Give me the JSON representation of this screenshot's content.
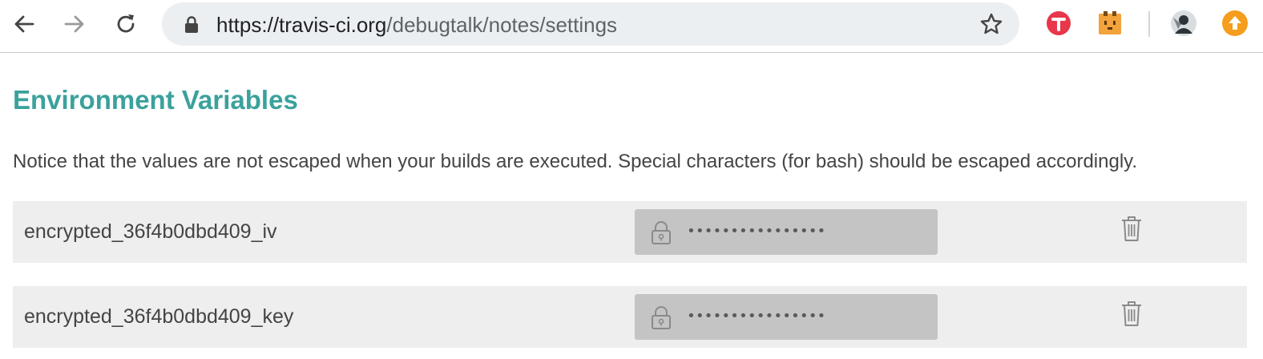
{
  "browser": {
    "url_host": "https://travis-ci.org",
    "url_path": "/debugtalk/notes/settings",
    "icons": [
      "back-arrow-icon",
      "forward-arrow-icon",
      "reload-icon",
      "lock-icon",
      "star-icon",
      "todoist-extension-icon",
      "extension-face-icon",
      "profile-avatar-icon",
      "update-arrow-icon"
    ],
    "colors": {
      "omnibox": "#eceff1",
      "update": "#f59d1d",
      "extension_red": "#e8364b"
    }
  },
  "settings": {
    "section_title": "Environment Variables",
    "notice": "Notice that the values are not escaped when your builds are executed. Special characters (for bash) should be escaped accordingly.",
    "variables": [
      {
        "name": "encrypted_36f4b0dbd409_iv",
        "value": "••••••••••••••••"
      },
      {
        "name": "encrypted_36f4b0dbd409_key",
        "value": "••••••••••••••••"
      }
    ],
    "colors": {
      "title": "#3ba19c",
      "row_bg": "#eeeeee",
      "value_bg": "#c4c4c4"
    }
  }
}
